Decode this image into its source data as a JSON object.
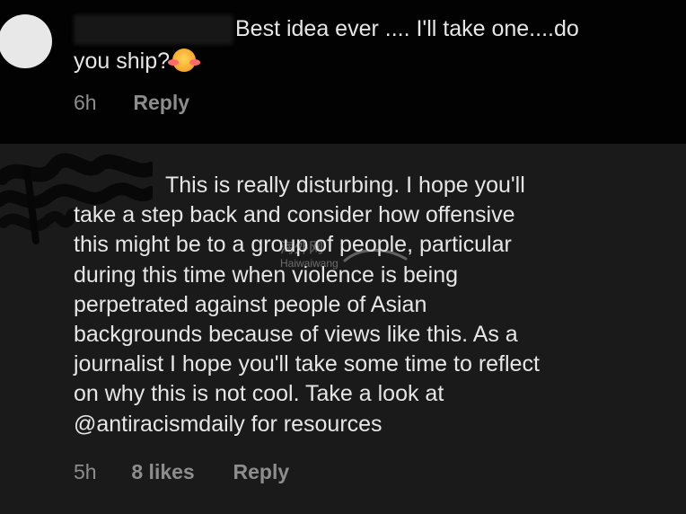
{
  "comment_1": {
    "text_line_1": "Best idea ever .... I'll take one....do",
    "text_line_2": "you ship?",
    "time": "6h",
    "reply_label": "Reply"
  },
  "comment_2": {
    "lines": [
      "This is really disturbing. I hope you'll",
      "take a step back and consider how offensive",
      "this might be to a group of people, particular",
      "during this time when violence is being",
      "perpetrated against people of Asian",
      "backgrounds because of views like this. As a",
      "journalist I hope you'll take some time to reflect",
      "on why this is not cool. Take a look at",
      "@antiracismdaily for resources"
    ],
    "time": "5h",
    "likes": "8 likes",
    "reply_label": "Reply"
  },
  "watermark": {
    "line_1": "海外网",
    "line_2": "Haiwaiwang"
  },
  "colors": {
    "background_top": "#020202",
    "background_bottom": "#1a1a1a",
    "text": "#e6e6e6",
    "meta": "#8d8d8d"
  },
  "icons": {
    "comment_1_emoji": "smiling-face-with-hearts-icon"
  }
}
